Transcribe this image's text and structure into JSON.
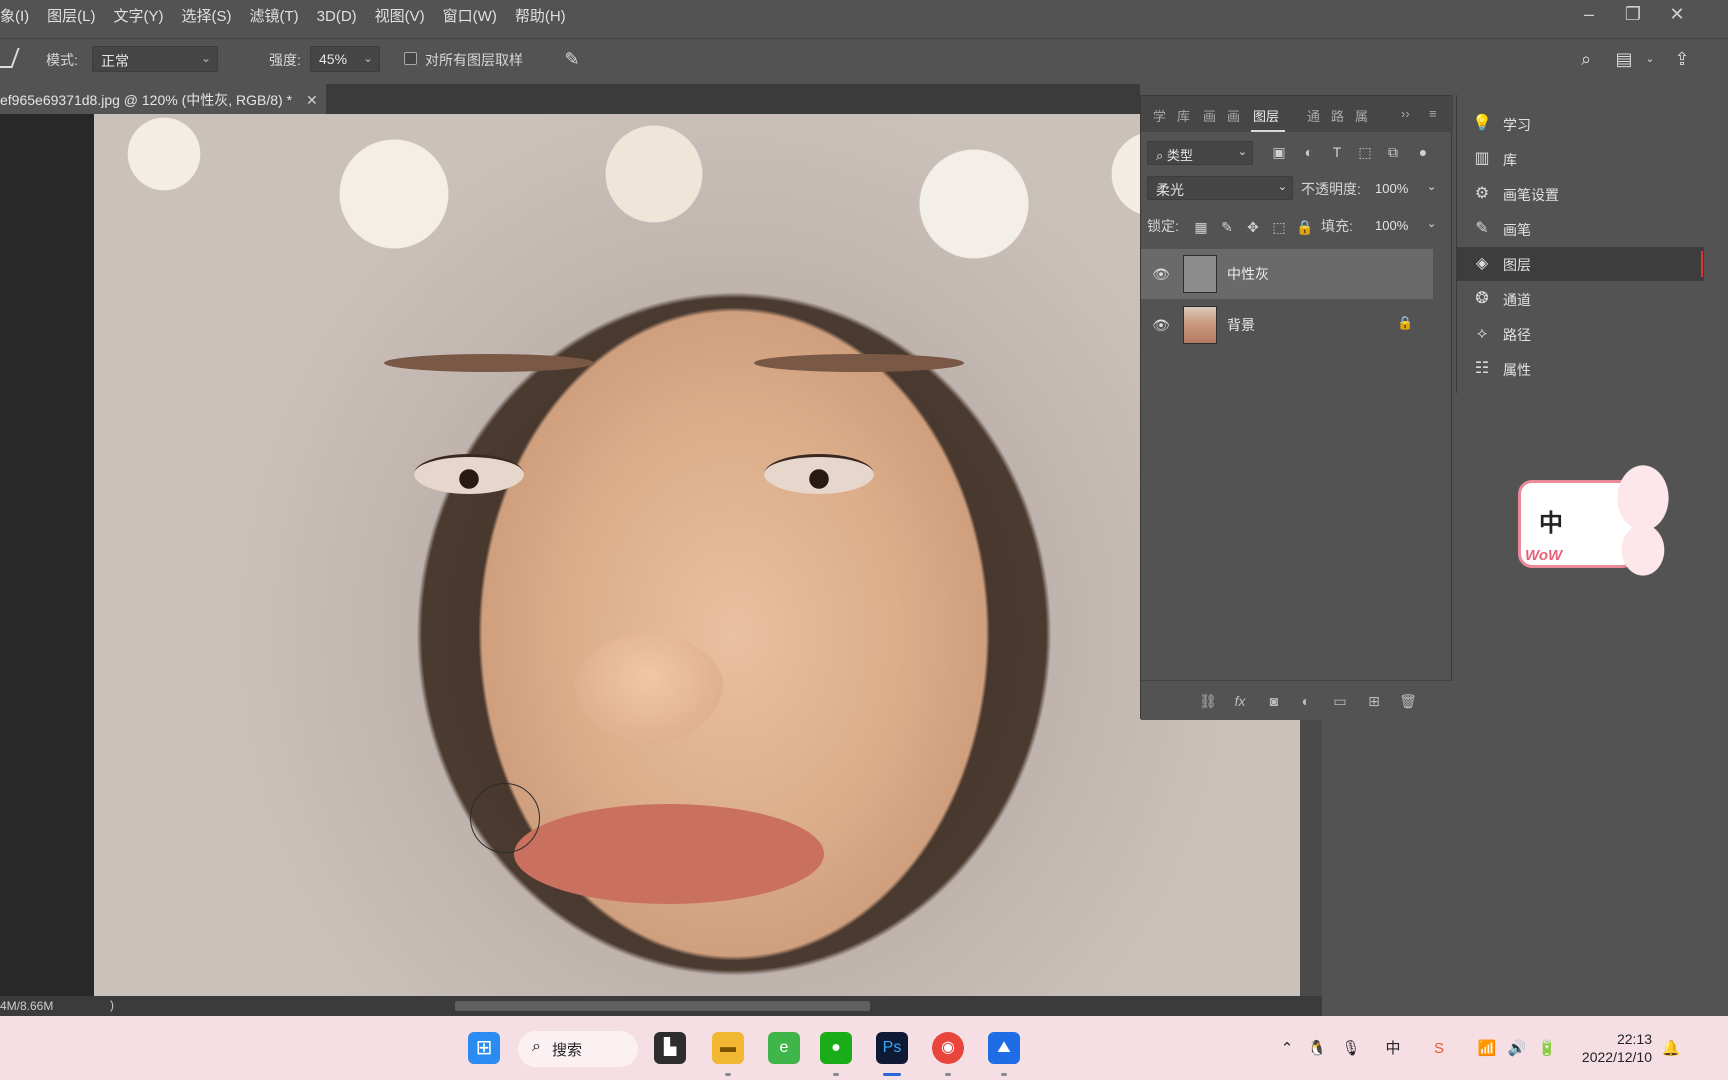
{
  "menubar": {
    "items": [
      "象(I)",
      "图层(L)",
      "文字(Y)",
      "选择(S)",
      "滤镜(T)",
      "3D(D)",
      "视图(V)",
      "窗口(W)",
      "帮助(H)"
    ]
  },
  "window_controls": {
    "minimize": "–",
    "restore": "❐",
    "close": "✕"
  },
  "options": {
    "mode_label": "模式:",
    "mode_value": "正常",
    "strength_label": "强度:",
    "strength_value": "45%",
    "sample_all_label": "对所有图层取样",
    "sample_all_checked": false
  },
  "document": {
    "tab_title": "ef965e69371d8.jpg  @  120% (中性灰, RGB/8) *",
    "close": "✕"
  },
  "status": {
    "doc_size": "4M/8.66M",
    "arrow": ")"
  },
  "layers_panel": {
    "tabs": [
      "学",
      "库",
      "画",
      "画",
      "图层",
      "通",
      "路",
      "属"
    ],
    "active_tab": "图层",
    "overflow": "››",
    "menu": "≡",
    "filter_kind": "类型",
    "blend_mode": "柔光",
    "opacity_label": "不透明度:",
    "opacity_value": "100%",
    "lock_label": "锁定:",
    "fill_label": "填充:",
    "fill_value": "100%",
    "layers": [
      {
        "name": "中性灰",
        "visible": true,
        "selected": true,
        "locked": false
      },
      {
        "name": "背景",
        "visible": true,
        "selected": false,
        "locked": true
      }
    ]
  },
  "dock": {
    "items": [
      {
        "label": "学习",
        "icon": "lightbulb-icon"
      },
      {
        "label": "库",
        "icon": "library-icon"
      },
      {
        "label": "画笔设置",
        "icon": "brush-settings-icon"
      },
      {
        "label": "画笔",
        "icon": "brush-icon"
      },
      {
        "label": "图层",
        "icon": "layers-icon"
      },
      {
        "label": "通道",
        "icon": "channels-icon"
      },
      {
        "label": "路径",
        "icon": "paths-icon"
      },
      {
        "label": "属性",
        "icon": "properties-icon"
      }
    ],
    "active": "图层"
  },
  "sticker": {
    "char": "中",
    "wow": "WoW"
  },
  "taskbar": {
    "search_label": "搜索",
    "clock_time": "22:13",
    "clock_date": "2022/12/10",
    "ime": "中",
    "accent_active": "#2b66d9"
  }
}
